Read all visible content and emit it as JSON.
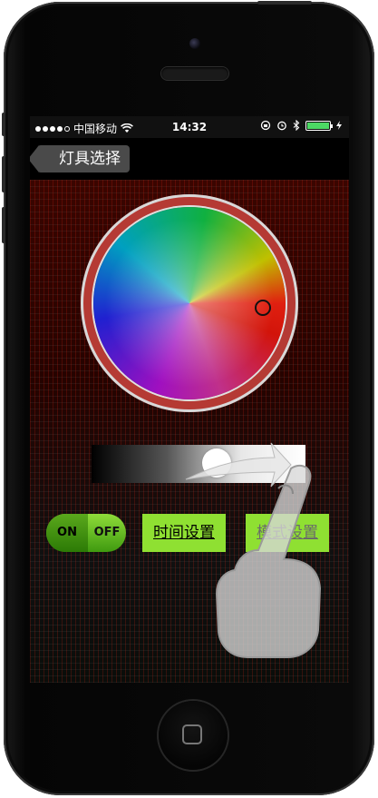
{
  "status_bar": {
    "carrier": "中国移动",
    "time": "14:32"
  },
  "nav": {
    "back_label": "灯具选择"
  },
  "toggle": {
    "on_label": "ON",
    "off_label": "OFF"
  },
  "buttons": {
    "time_setting": "时间设置",
    "mode_setting": "模式设置"
  },
  "brightness": 0.6,
  "colors": {
    "ring": "#b53a34",
    "accent_green": "#8fe032",
    "battery": "#4cd964"
  }
}
